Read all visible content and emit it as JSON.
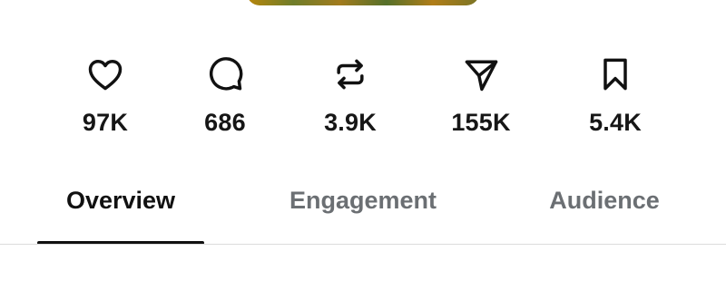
{
  "stats": [
    {
      "id": "likes",
      "icon": "heart-icon",
      "count": "97K"
    },
    {
      "id": "comments",
      "icon": "comment-icon",
      "count": "686"
    },
    {
      "id": "reposts",
      "icon": "repost-icon",
      "count": "3.9K"
    },
    {
      "id": "shares",
      "icon": "send-icon",
      "count": "155K"
    },
    {
      "id": "saves",
      "icon": "bookmark-icon",
      "count": "5.4K"
    }
  ],
  "tabs": [
    {
      "label": "Overview",
      "active": true
    },
    {
      "label": "Engagement",
      "active": false
    },
    {
      "label": "Audience",
      "active": false
    }
  ],
  "colors": {
    "text_primary": "#111111",
    "text_inactive": "#6b6f73",
    "divider": "#dcdcdc"
  }
}
